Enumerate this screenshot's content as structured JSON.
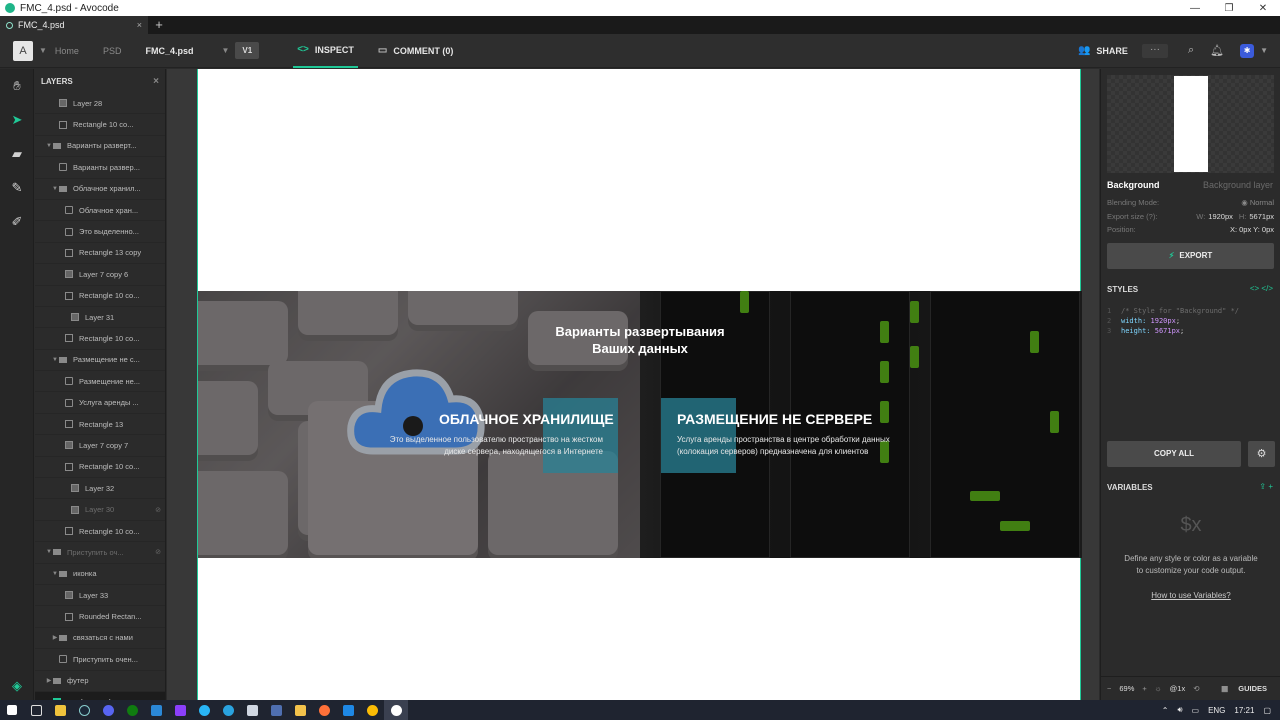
{
  "window": {
    "title": "FMC_4.psd - Avocode",
    "controls": [
      "—",
      "❐",
      "✕"
    ]
  },
  "tabs": {
    "doc": "FMC_4.psd",
    "close": "×",
    "new": "+"
  },
  "topbar": {
    "logo": "A",
    "crumbs": [
      "Home",
      "PSD"
    ],
    "file": "FMC_4.psd",
    "version": "V1",
    "inspect": "INSPECT",
    "comment": "COMMENT (0)",
    "share": "SHARE",
    "more": "···"
  },
  "layers_panel": {
    "title": "LAYERS",
    "close": "×",
    "items": [
      {
        "name": "Layer 28",
        "type": "img",
        "depth": 2,
        "dim": false
      },
      {
        "name": "Rectangle 10 co...",
        "type": "shape",
        "depth": 2,
        "dim": false
      },
      {
        "name": "Варианты разверт...",
        "type": "folder",
        "depth": 1,
        "dim": false,
        "open": true
      },
      {
        "name": "Варианты развер...",
        "type": "txt",
        "depth": 2,
        "dim": false
      },
      {
        "name": "Облачное хранил...",
        "type": "folder",
        "depth": 2,
        "dim": false,
        "open": true
      },
      {
        "name": "Облачное хран...",
        "type": "txt",
        "depth": 3,
        "dim": false
      },
      {
        "name": "Это выделенно...",
        "type": "txt",
        "depth": 3,
        "dim": false
      },
      {
        "name": "Rectangle 13 copy",
        "type": "shape",
        "depth": 3,
        "dim": false
      },
      {
        "name": "Layer 7 copy 6",
        "type": "img",
        "depth": 3,
        "dim": false
      },
      {
        "name": "Rectangle 10 co...",
        "type": "shape",
        "depth": 3,
        "dim": false
      },
      {
        "name": "Layer 31",
        "type": "img",
        "depth": 4,
        "dim": false
      },
      {
        "name": "Rectangle 10 co...",
        "type": "shape",
        "depth": 3,
        "dim": false
      },
      {
        "name": "Размещение не с...",
        "type": "folder",
        "depth": 2,
        "dim": false,
        "open": true
      },
      {
        "name": "Размещение не...",
        "type": "txt",
        "depth": 3,
        "dim": false
      },
      {
        "name": "Услуга аренды ...",
        "type": "txt",
        "depth": 3,
        "dim": false
      },
      {
        "name": "Rectangle 13",
        "type": "shape",
        "depth": 3,
        "dim": false
      },
      {
        "name": "Layer 7 copy 7",
        "type": "img",
        "depth": 3,
        "dim": false
      },
      {
        "name": "Rectangle 10 co...",
        "type": "shape",
        "depth": 3,
        "dim": false
      },
      {
        "name": "Layer 32",
        "type": "img",
        "depth": 4,
        "dim": false
      },
      {
        "name": "Layer 30",
        "type": "img",
        "depth": 4,
        "dim": true
      },
      {
        "name": "Rectangle 10 co...",
        "type": "shape",
        "depth": 3,
        "dim": false
      },
      {
        "name": "Приступить оч...",
        "type": "folder",
        "depth": 1,
        "dim": true,
        "open": true
      },
      {
        "name": "иконка",
        "type": "folder",
        "depth": 2,
        "dim": false,
        "open": true
      },
      {
        "name": "Layer 33",
        "type": "img",
        "depth": 3,
        "dim": false
      },
      {
        "name": "Rounded Rectan...",
        "type": "shape",
        "depth": 3,
        "dim": false
      },
      {
        "name": "связаться с нами",
        "type": "folder",
        "depth": 2,
        "dim": false,
        "open": false
      },
      {
        "name": "Приступить очен...",
        "type": "txt",
        "depth": 2,
        "dim": false
      },
      {
        "name": "футер",
        "type": "folder",
        "depth": 1,
        "dim": false,
        "open": false
      },
      {
        "name": "Background",
        "type": "img",
        "depth": 1,
        "dim": false,
        "selected": true
      }
    ]
  },
  "canvas": {
    "hero_title_1": "Варианты развертывания",
    "hero_title_2": "Ваших данных",
    "svc1_title": "ОБЛАЧНОЕ ХРАНИЛИЩЕ",
    "svc1_line1": "Это выделенное пользователю пространство на жестком",
    "svc1_line2": "диске сервера, находящегося в Интернете",
    "svc2_title": "РАЗМЕЩЕНИЕ НЕ СЕРВЕРЕ",
    "svc2_line1": "Услуга аренды пространства в центре обработки данных",
    "svc2_line2": "(колокация серверов) предназначена для клиентов"
  },
  "inspector": {
    "layer_name": "Background",
    "layer_type": "Background layer",
    "blending_label": "Blending Mode:",
    "blending_value": "Normal",
    "export_label": "Export size (?):",
    "w_label": "W:",
    "w_value": "1920px",
    "h_label": "H:",
    "h_value": "5671px",
    "position_label": "Position:",
    "position_value": "X: 0px Y: 0px",
    "export_btn": "EXPORT",
    "styles_title": "STYLES",
    "code_comment": "/* Style for \"Background\" */",
    "code_width_prop": "width:",
    "code_width_val": "1920px",
    "code_height_prop": "height:",
    "code_height_val": "5671px",
    "copy_all": "COPY ALL",
    "variables_title": "VARIABLES",
    "var_symbol": "$x",
    "var_desc_1": "Define any style or color as a variable",
    "var_desc_2": "to customize your code output.",
    "var_link": "How to use Variables?",
    "zoom": "69%",
    "scale": "@1x",
    "guides": "GUIDES"
  },
  "taskbar": {
    "lang": "ENG",
    "time": "17:21"
  },
  "colors": {
    "accent": "#20c997",
    "rack_led": "#64c31d"
  }
}
